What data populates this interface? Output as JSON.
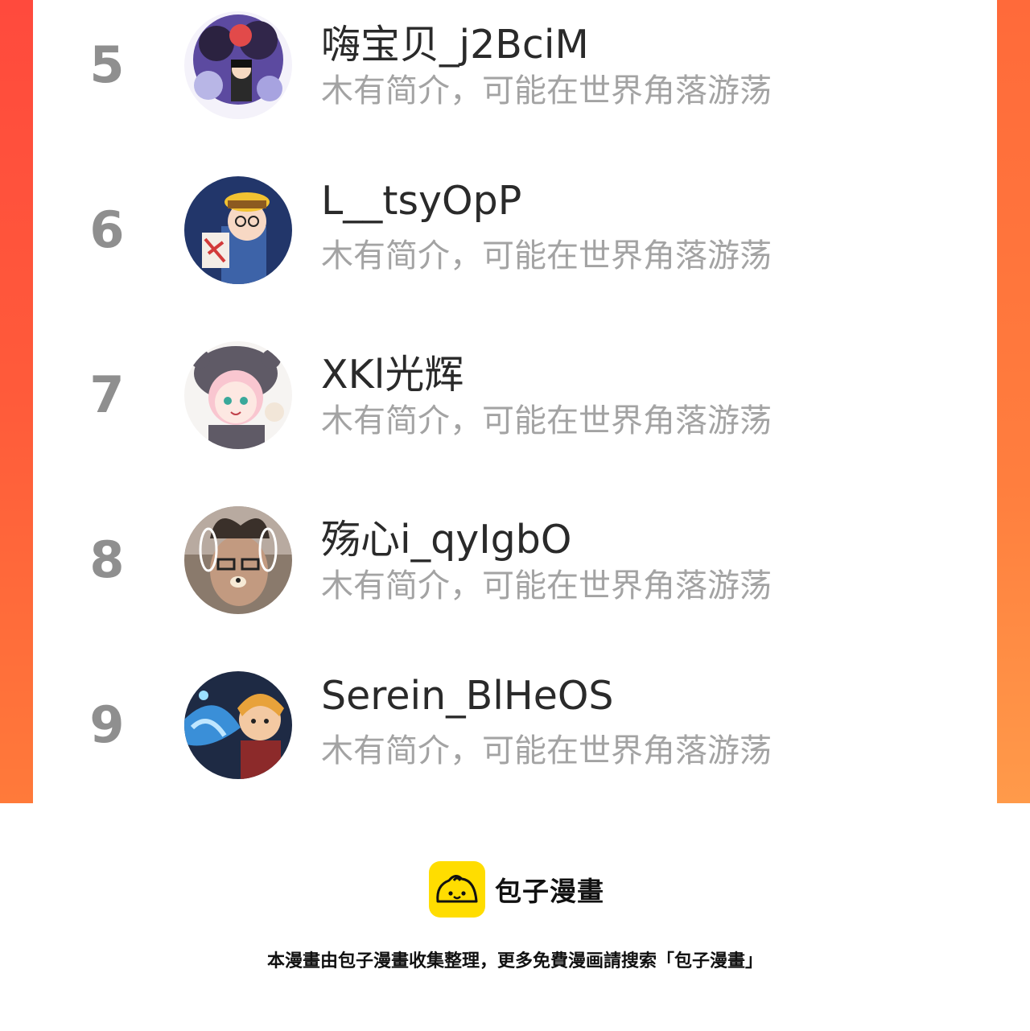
{
  "rankings": [
    {
      "rank": "5",
      "name": "嗨宝贝_j2BciM",
      "bio": "木有简介，可能在世界角落游荡",
      "avatar_icon": "avatar-dark-creatures-icon"
    },
    {
      "rank": "6",
      "name": "L__tsyOpP",
      "bio": "木有简介，可能在世界角落游荡",
      "avatar_icon": "avatar-cartoon-man-hat-icon"
    },
    {
      "rank": "7",
      "name": "XKl光辉",
      "bio": "木有简介，可能在世界角落游荡",
      "avatar_icon": "avatar-anime-girl-icon"
    },
    {
      "rank": "8",
      "name": "殇心i_qyIgbO",
      "bio": "木有简介，可能在世界角落游荡",
      "avatar_icon": "avatar-photo-dog-filter-icon"
    },
    {
      "rank": "9",
      "name": "Serein_BlHeOS",
      "bio": "木有简介，可能在世界角落游荡",
      "avatar_icon": "avatar-anime-boy-icon"
    }
  ],
  "footer": {
    "brand_name": "包子漫畫",
    "notice": "本漫畫由包子漫畫收集整理，更多免費漫画請搜索「包子漫畫」",
    "logo_icon": "baozi-logo-icon",
    "logo_color": "#ffdd00"
  },
  "colors": {
    "frame": "#ff5b3a",
    "rank_text": "#8f8f8f",
    "bio_text": "#a3a3a3"
  }
}
